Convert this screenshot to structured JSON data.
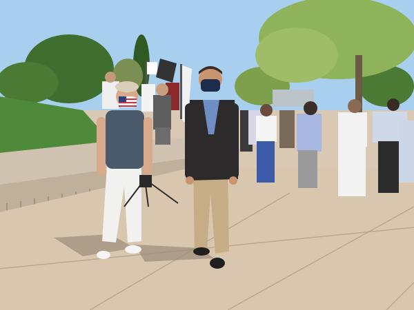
{
  "scene": {
    "description_type": "outdoor-photo",
    "colors": {
      "sky": "#a9cfee",
      "grass": "#4f8a3a",
      "pavement": "#d8c6ae",
      "pavement_shadow": "#9c8c78",
      "tree_dark": "#3f6e2f",
      "tree_light": "#8fb35a",
      "blazer": "#2d2a2c",
      "pants_khaki": "#c7ad85",
      "white_pants": "#f1f1ef",
      "vest": "#4a5a6a",
      "mask_flag_red": "#c8323c",
      "mask_flag_blue": "#2d3f7a",
      "mask_navy": "#1f2b4a"
    }
  }
}
